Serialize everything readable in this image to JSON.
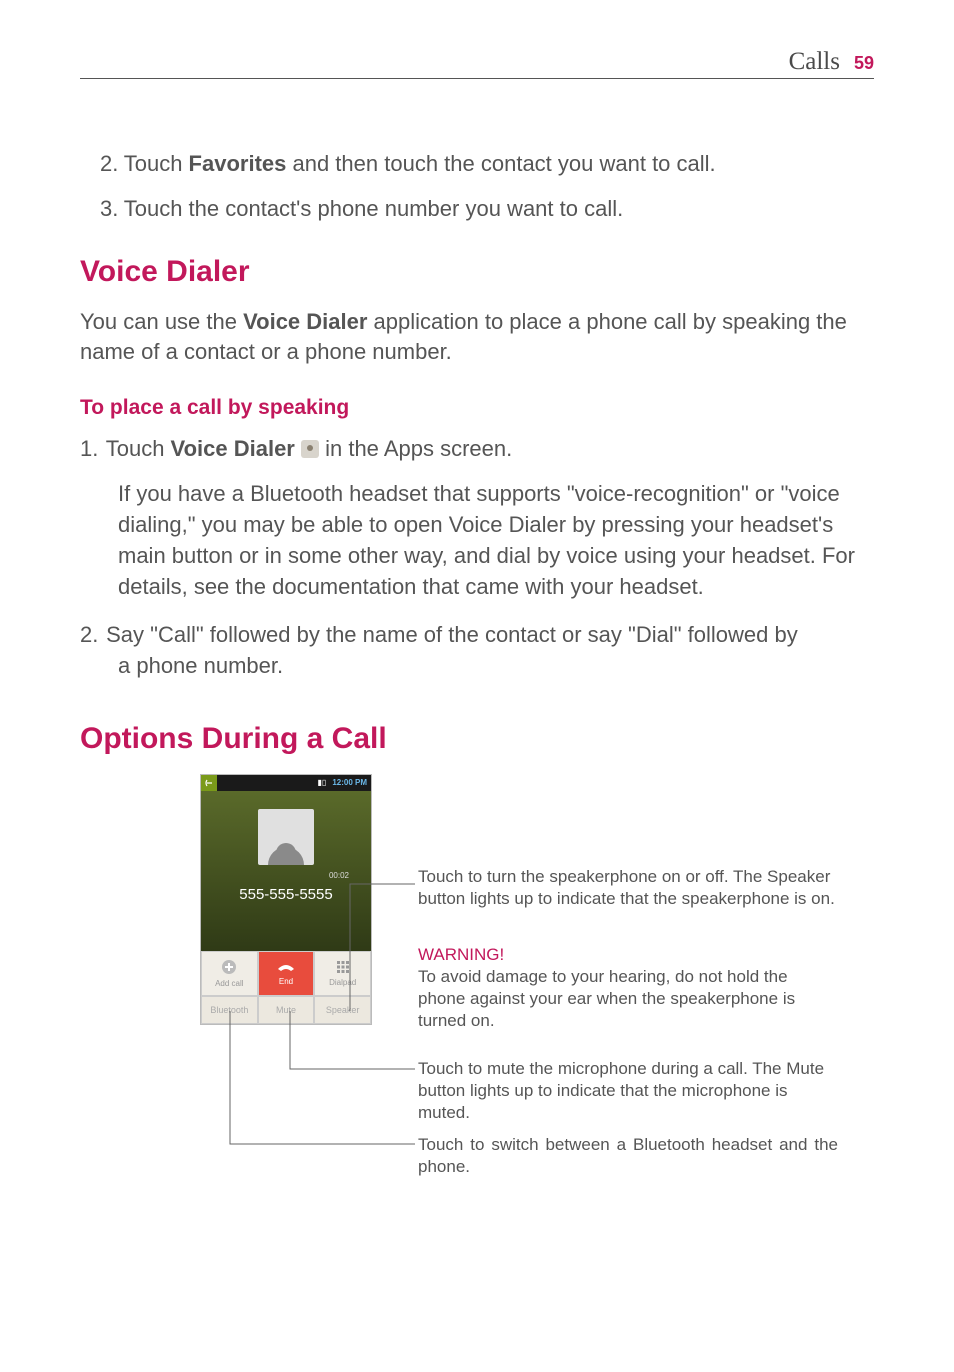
{
  "header": {
    "section": "Calls",
    "page": "59"
  },
  "steps_top": {
    "s2_num": "2.",
    "s2_text_a": "Touch ",
    "s2_bold": "Favorites",
    "s2_text_b": " and then touch the contact you want to call.",
    "s3_num": "3.",
    "s3_text": "Touch the contact's phone number you want to call."
  },
  "voice": {
    "heading": "Voice Dialer",
    "p_a": "You can use the ",
    "p_bold": "Voice Dialer",
    "p_b": " application to place a phone call by speaking the name of a contact or a phone number.",
    "sub": "To place a call by speaking",
    "s1_num": "1.",
    "s1_a": "Touch ",
    "s1_bold": "Voice Dialer ",
    "s1_b": " in the Apps screen.",
    "s1_detail": "If you have a Bluetooth headset that supports \"voice-recognition\" or \"voice dialing,\" you may be able to open Voice Dialer by pressing your headset's main button or in some other way, and dial by voice using your headset. For details, see the documentation that came with your headset.",
    "s2_num": "2.",
    "s2_a": "Say \"Call\" followed by the name of the contact or say \"Dial\" followed by",
    "s2_b": "a phone number."
  },
  "options": {
    "heading": "Options During a Call",
    "phone": {
      "time": "12:00 PM",
      "duration": "00:02",
      "number": "555-555-5555",
      "btn_addcall": "Add call",
      "btn_end": "End",
      "btn_dialpad": "Dialpad",
      "btn_bt": "Bluetooth",
      "btn_mute": "Mute",
      "btn_speaker": "Speaker"
    },
    "c_speaker": "Touch to turn the speakerphone on or off. The Speaker button lights up to indicate that the speakerphone is on.",
    "c_warn_h": "WARNING!",
    "c_warn": "To avoid damage to your hearing, do not hold the phone against your ear when the speakerphone is turned on.",
    "c_mute": "Touch to mute the microphone during a call. The Mute button lights up to indicate that the microphone is muted.",
    "c_bt": "Touch to switch between a Bluetooth headset and the phone."
  }
}
